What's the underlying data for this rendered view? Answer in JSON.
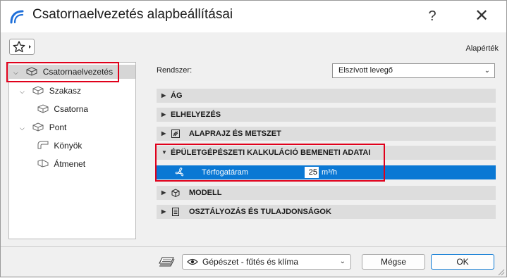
{
  "window": {
    "title": "Csatornaelvezetés alapbeállításai",
    "help_label": "?",
    "close_label": "✕"
  },
  "toolbar": {
    "favorites_icon": "star-icon",
    "defaults_label": "Alapérték"
  },
  "tree": {
    "root": {
      "label": "Csatornaelvezetés",
      "expanded": true,
      "selected": true
    },
    "items": [
      {
        "label": "Szakasz",
        "expanded": true
      },
      {
        "label": "Csatorna"
      },
      {
        "label": "Pont",
        "expanded": true
      },
      {
        "label": "Könyök"
      },
      {
        "label": "Átmenet"
      }
    ]
  },
  "system": {
    "label": "Rendszer:",
    "value": "Elszívott levegő"
  },
  "sections": [
    {
      "label": "ÁG",
      "expanded": false
    },
    {
      "label": "ELHELYEZÉS",
      "expanded": false
    },
    {
      "label": "ALAPRAJZ ÉS METSZET",
      "expanded": false
    },
    {
      "label": "ÉPÜLETGÉPÉSZETI KALKULÁCIÓ BEMENETI ADATAI",
      "expanded": true
    },
    {
      "label": "MODELL",
      "expanded": false
    },
    {
      "label": "OSZTÁLYOZÁS ÉS TULAJDONSÁGOK",
      "expanded": false
    }
  ],
  "property": {
    "label": "Térfogatáram",
    "value": "25",
    "unit": "m³/h"
  },
  "footer": {
    "layer_value": "Gépészet - fűtés és klíma",
    "cancel_label": "Mégse",
    "ok_label": "OK"
  },
  "colors": {
    "highlight_box": "#e0001b",
    "selection_blue": "#0a78d4",
    "logo_blue": "#1e6fd9"
  }
}
